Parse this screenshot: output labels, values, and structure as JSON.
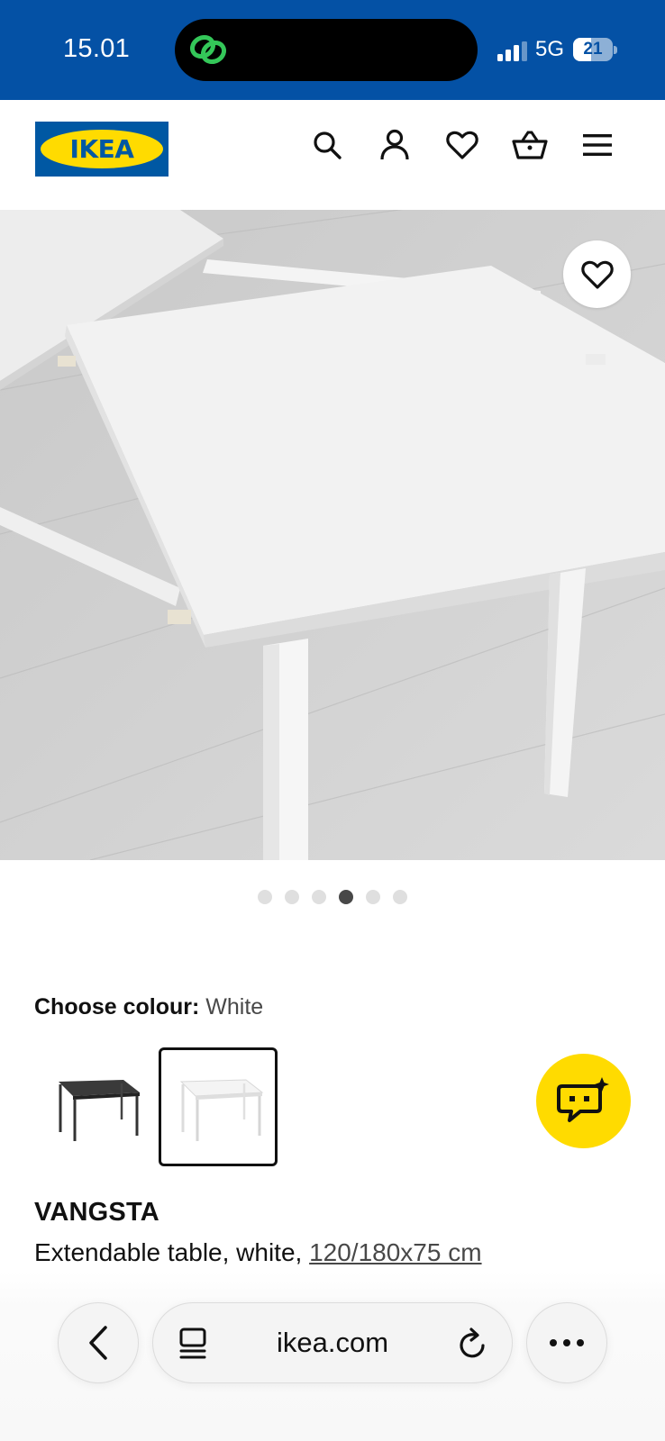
{
  "status_bar": {
    "time": "15.01",
    "network": "5G",
    "battery": "21"
  },
  "header": {
    "logo_text": "IKEA",
    "icons": [
      "search-icon",
      "account-icon",
      "favourites-icon",
      "basket-icon",
      "menu-icon"
    ]
  },
  "gallery": {
    "image_count": 6,
    "active_index": 3,
    "favourite_icon": "heart-icon"
  },
  "colour": {
    "label": "Choose colour:",
    "selected": "White",
    "options": [
      "black-table-swatch",
      "white-table-swatch"
    ]
  },
  "product": {
    "name": "VANGSTA",
    "description": "Extendable table, white, ",
    "dimensions": "120/180x75 cm"
  },
  "browser": {
    "url": "ikea.com"
  },
  "colors": {
    "brand_blue": "#0058a3",
    "brand_yellow": "#ffdb00",
    "status_blue": "#0451a5"
  }
}
